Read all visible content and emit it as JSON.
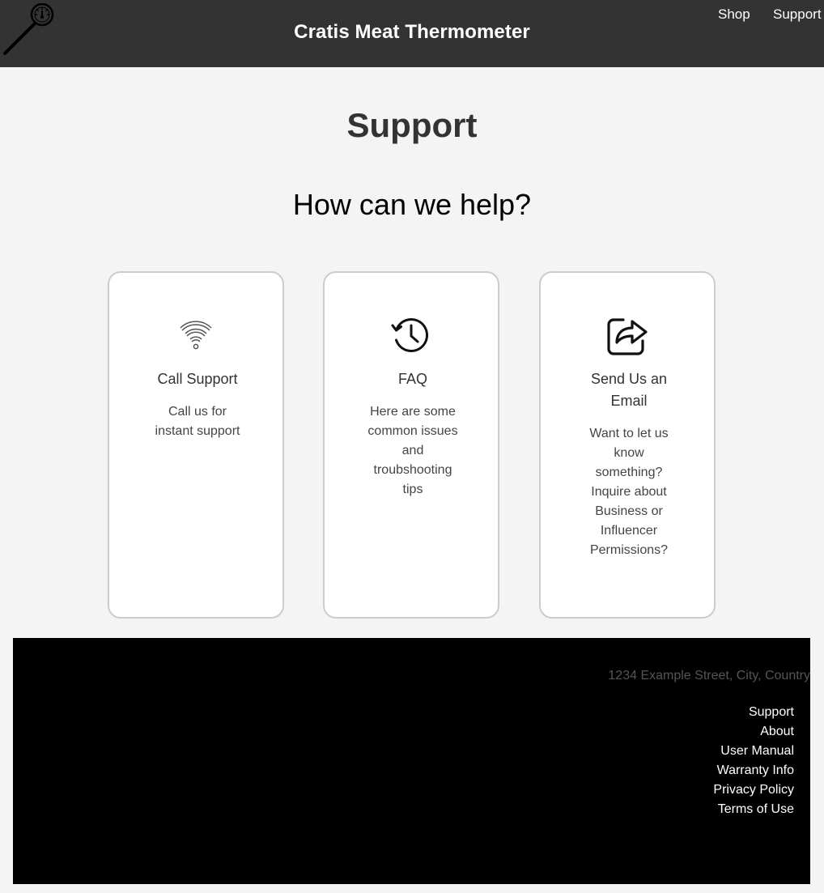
{
  "header": {
    "brand": "Cratis Meat Thermometer",
    "logo_icon": "meat-thermometer-icon",
    "nav": {
      "shop": "Shop",
      "support": "Support"
    },
    "background": "#333333"
  },
  "main": {
    "title": "Support",
    "subtitle": "How can we help?",
    "cards": [
      {
        "icon": "wifi-icon",
        "title": "Call Support",
        "text": "Call us for instant support"
      },
      {
        "icon": "history-clock-icon",
        "title": "FAQ",
        "text": "Here are some common issues and troubshooting tips"
      },
      {
        "icon": "share-icon",
        "title": "Send Us an Email",
        "text": "Want to let us know something? Inquire about Business or Influencer Permissions?"
      }
    ]
  },
  "footer": {
    "address": "1234 Example Street, City, Country",
    "links": [
      "Support",
      "About",
      "User Manual",
      "Warranty Info",
      "Privacy Policy",
      "Terms of Use"
    ],
    "background": "#000000"
  }
}
